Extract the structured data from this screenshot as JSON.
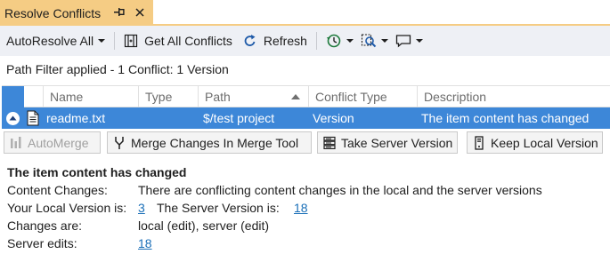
{
  "tab": {
    "title": "Resolve Conflicts",
    "pin_icon": "pin-icon",
    "close_icon": "close-icon"
  },
  "toolbar": {
    "autoresolve_label": "AutoResolve All",
    "get_all_label": "Get All Conflicts",
    "refresh_label": "Refresh",
    "icons": [
      "get-all-conflicts-icon",
      "refresh-icon",
      "history-icon",
      "find-icon",
      "comment-icon"
    ]
  },
  "path_filter_text": "Path Filter applied - 1 Conflict: 1 Version",
  "grid": {
    "columns": [
      "Name",
      "Type",
      "Path",
      "Conflict Type",
      "Description"
    ],
    "sorted_column": "Path",
    "rows": [
      {
        "name": "readme.txt",
        "type": "",
        "path": "$/test project",
        "conflict_type": "Version",
        "description": "The item content has changed"
      }
    ]
  },
  "actions": {
    "automerge_label": "AutoMerge",
    "merge_tool_label": "Merge Changes In Merge Tool",
    "take_server_label": "Take Server Version",
    "keep_local_label": "Keep Local Version"
  },
  "details": {
    "heading": "The item content has changed",
    "content_changes_label": "Content Changes:",
    "content_changes_value": "There are conflicting content changes in the local and the server versions",
    "local_version_label": "Your Local Version is:",
    "local_version_value": "3",
    "server_version_label": "The Server Version is:",
    "server_version_value": "18",
    "changes_are_label": "Changes are:",
    "changes_are_value": "local (edit), server (edit)",
    "server_edits_label": "Server edits:",
    "server_edits_value": "18"
  },
  "colors": {
    "tab_accent": "#f5cc84",
    "selection": "#3d87d8",
    "toolbar_bg": "#eef0f5",
    "link": "#1a6fb8"
  }
}
